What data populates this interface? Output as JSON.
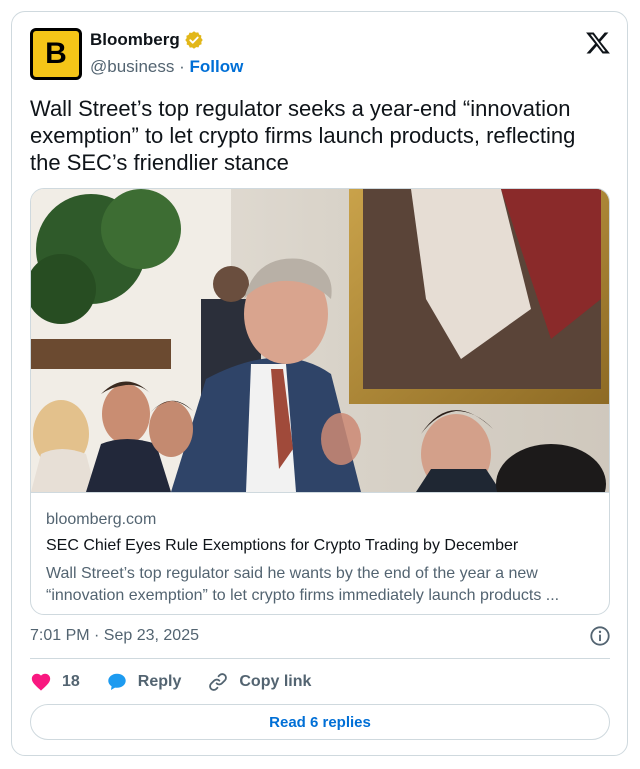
{
  "author": {
    "display_name": "Bloomberg",
    "avatar_letter": "B",
    "handle": "@business",
    "separator": "·",
    "follow_label": "Follow"
  },
  "tweet": {
    "text": "Wall Street’s top regulator seeks a year-end “innovation exemption” to let crypto firms launch products, reflecting the SEC’s friendlier stance"
  },
  "link_card": {
    "domain": "bloomberg.com",
    "title": "SEC Chief Eyes Rule Exemptions for Crypto Trading by December",
    "description": "Wall Street’s top regulator said he wants by the end of the year a new “innovation exemption” to let crypto firms immediately launch products ..."
  },
  "meta": {
    "timestamp": "7:01 PM · Sep 23, 2025"
  },
  "actions": {
    "like_count": "18",
    "reply_label": "Reply",
    "copy_link_label": "Copy link"
  },
  "footer": {
    "read_replies_label": "Read 6 replies"
  },
  "icons": {
    "verified": "verified-badge-icon",
    "x_logo": "x-logo-icon",
    "info": "info-icon",
    "like": "heart-icon",
    "reply": "speech-bubble-icon",
    "copy_link": "link-icon"
  },
  "colors": {
    "accent_blue": "#006fd6",
    "like_pink": "#f91880",
    "reply_blue": "#1d9bf0",
    "gold_badge": "#e2b719",
    "avatar_yellow": "#f5c518",
    "muted_text": "#536471",
    "border": "#cfd9de"
  }
}
